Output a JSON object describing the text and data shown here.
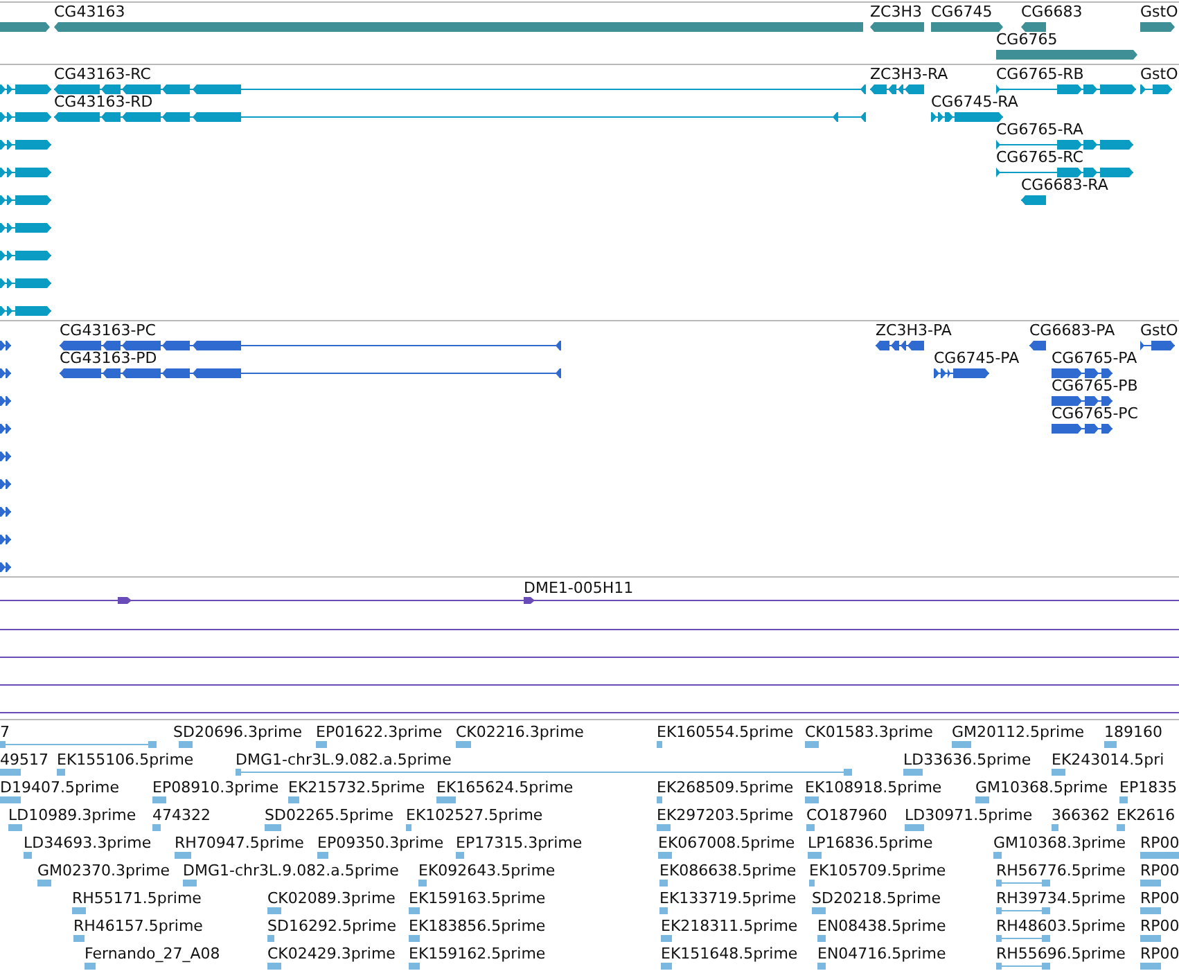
{
  "tracks": [
    {
      "kind": "gene",
      "color": "#3f8f96",
      "features": [
        {
          "reverse": false
        },
        {
          "label": "CG43163",
          "reverse": true
        },
        {
          "label": "ZC3H3",
          "reverse": true
        },
        {
          "label": "CG6745",
          "reverse": false
        },
        {
          "label": "CG6683",
          "reverse": true
        },
        {
          "label": "GstO",
          "reverse": false
        },
        {
          "label": "CG6765",
          "reverse": false
        }
      ]
    },
    {
      "kind": "transcript",
      "color": "#0b9cc4",
      "features": [
        {
          "label": "CG43163-RC",
          "reverse": true
        },
        {
          "label": "ZC3H3-RA",
          "reverse": true
        },
        {
          "label": "CG6765-RB",
          "reverse": false
        },
        {
          "label": "GstO",
          "reverse": false
        },
        {
          "label": "CG43163-RD",
          "reverse": true
        },
        {
          "label": "CG6745-RA",
          "reverse": false
        },
        {
          "label": "CG6765-RA",
          "reverse": false
        },
        {
          "label": "CG6765-RC",
          "reverse": false
        },
        {
          "label": "CG6683-RA",
          "reverse": true
        },
        {
          "reverse": false
        },
        {
          "reverse": false
        },
        {
          "reverse": false
        },
        {
          "reverse": false
        },
        {
          "reverse": false
        },
        {
          "reverse": false
        },
        {
          "reverse": false
        },
        {
          "reverse": false
        },
        {
          "reverse": false
        }
      ]
    },
    {
      "kind": "protein",
      "color": "#2f6ad0",
      "features": [
        {
          "label": "CG43163-PC",
          "reverse": true
        },
        {
          "label": "ZC3H3-PA",
          "reverse": true
        },
        {
          "label": "CG6683-PA",
          "reverse": true
        },
        {
          "label": "GstO",
          "reverse": false
        },
        {
          "label": "CG43163-PD",
          "reverse": true
        },
        {
          "label": "CG6745-PA",
          "reverse": false
        },
        {
          "label": "CG6765-PA",
          "reverse": false
        },
        {
          "label": "CG6765-PB",
          "reverse": false
        },
        {
          "label": "CG6765-PC",
          "reverse": false
        },
        {
          "reverse": false
        },
        {
          "reverse": false
        },
        {
          "reverse": false
        },
        {
          "reverse": false
        },
        {
          "reverse": false
        },
        {
          "reverse": false
        },
        {
          "reverse": false
        },
        {
          "reverse": false
        },
        {
          "reverse": false
        }
      ]
    },
    {
      "kind": "clone",
      "color": "#6a4cb8",
      "features": [
        {
          "kind": "clone",
          "label": "DME1-005H11",
          "reverse": false
        },
        {
          "kind": "line"
        },
        {
          "kind": "line"
        },
        {
          "kind": "line"
        },
        {
          "kind": "line"
        }
      ]
    },
    {
      "kind": "est",
      "color": "#7ab8e0",
      "features": [
        {
          "label": "7"
        },
        {
          "label": "SD20696.3prime"
        },
        {
          "label": "EP01622.3prime"
        },
        {
          "label": "CK02216.3prime"
        },
        {
          "label": "EK160554.5prime"
        },
        {
          "label": "CK01583.3prime"
        },
        {
          "label": "GM20112.5prime"
        },
        {
          "label": "189160"
        },
        {
          "label": "49517"
        },
        {
          "label": "EK155106.5prime"
        },
        {
          "label": "DMG1-chr3L.9.082.a.5prime"
        },
        {
          "label": "LD33636.5prime"
        },
        {
          "label": "EK243014.5pri"
        },
        {
          "label": "D19407.5prime"
        },
        {
          "label": "EP08910.3prime"
        },
        {
          "label": "EK215732.5prime"
        },
        {
          "label": "EK165624.5prime"
        },
        {
          "label": "EK268509.5prime"
        },
        {
          "label": "EK108918.5prime"
        },
        {
          "label": "GM10368.5prime"
        },
        {
          "label": "EP1835"
        },
        {
          "label": "LD10989.3prime"
        },
        {
          "label": "474322"
        },
        {
          "label": "SD02265.5prime"
        },
        {
          "label": "EK102527.5prime"
        },
        {
          "label": "EK297203.5prime"
        },
        {
          "label": "CO187960"
        },
        {
          "label": "LD30971.5prime"
        },
        {
          "label": "366362"
        },
        {
          "label": "EK2616"
        },
        {
          "label": "LD34693.3prime"
        },
        {
          "label": "RH70947.5prime"
        },
        {
          "label": "EP09350.3prime"
        },
        {
          "label": "EP17315.3prime"
        },
        {
          "label": "EK067008.5prime"
        },
        {
          "label": "LP16836.5prime"
        },
        {
          "label": "GM10368.3prime"
        },
        {
          "label": "RP00"
        },
        {
          "label": "GM02370.3prime"
        },
        {
          "label": "DMG1-chr3L.9.082.a.5prime"
        },
        {
          "label": "EK092643.5prime"
        },
        {
          "label": "EK086638.5prime"
        },
        {
          "label": "EK105709.5prime"
        },
        {
          "label": "RH56776.5prime"
        },
        {
          "label": "RP00"
        },
        {
          "label": "RH55171.5prime"
        },
        {
          "label": "CK02089.3prime"
        },
        {
          "label": "EK159163.5prime"
        },
        {
          "label": "EK133719.5prime"
        },
        {
          "label": "SD20218.5prime"
        },
        {
          "label": "RH39734.5prime"
        },
        {
          "label": "RP00"
        },
        {
          "label": "RH46157.5prime"
        },
        {
          "label": "SD16292.5prime"
        },
        {
          "label": "EK183856.5prime"
        },
        {
          "label": "EK218311.5prime"
        },
        {
          "label": "EN08438.5prime"
        },
        {
          "label": "RH48603.5prime"
        },
        {
          "label": "RP00"
        },
        {
          "label": "Fernando_27_A08"
        },
        {
          "label": "CK02429.3prime"
        },
        {
          "label": "EK159162.5prime"
        },
        {
          "label": "EK151648.5prime"
        },
        {
          "label": "EN04716.5prime"
        },
        {
          "label": "RH55696.5prime"
        },
        {
          "label": "RP00"
        }
      ]
    }
  ]
}
